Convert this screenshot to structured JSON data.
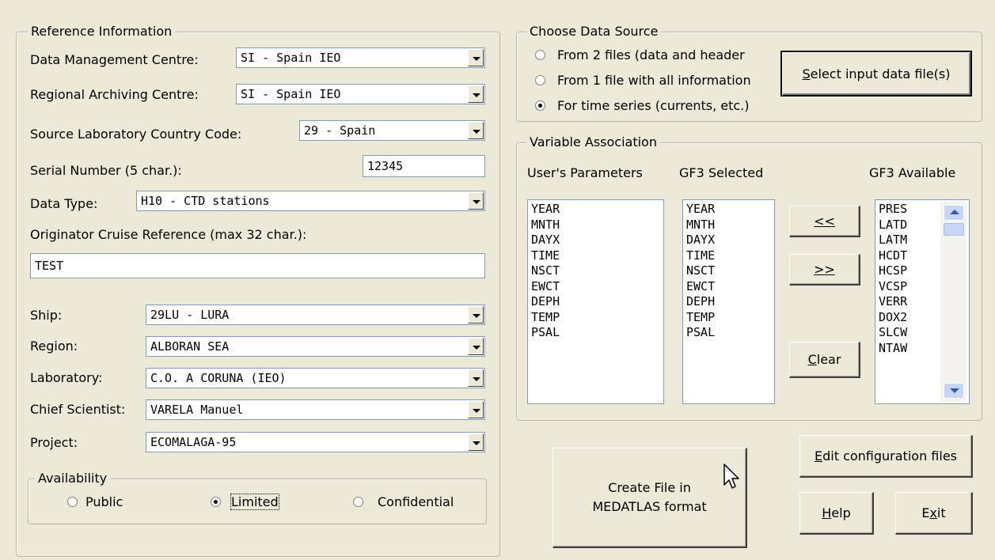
{
  "reference": {
    "legend": "Reference Information",
    "dmc_label": "Data Management Centre:",
    "dmc_value": "SI - Spain IEO",
    "rac_label": "Regional Archiving Centre:",
    "rac_value": "SI - Spain IEO",
    "country_label": "Source Laboratory Country Code:",
    "country_value": "29 - Spain",
    "serial_label": "Serial Number (5 char.):",
    "serial_value": "12345",
    "datatype_label": "Data Type:",
    "datatype_value": "H10 - CTD stations",
    "cruise_label": "Originator Cruise Reference (max 32 char.):",
    "cruise_value": "TEST",
    "ship_label": "Ship:",
    "ship_value": "29LU - LURA",
    "region_label": "Region:",
    "region_value": "ALBORAN SEA",
    "lab_label": "Laboratory:",
    "lab_value": "C.O. A CORUNA (IEO)",
    "chief_label": "Chief Scientist:",
    "chief_value": "VARELA Manuel",
    "project_label": "Project:",
    "project_value": "ECOMALAGA-95"
  },
  "availability": {
    "legend": "Availability",
    "options": [
      "Public",
      "Limited",
      "Confidential"
    ],
    "selected": "Limited"
  },
  "source": {
    "legend": "Choose Data Source",
    "options": [
      "From 2 files (data and header",
      "From 1 file with all information",
      "For time series (currents, etc.)"
    ],
    "selected": "For time series (currents, etc.)",
    "select_button_prefix": "S",
    "select_button_rest": "elect input data file(s)"
  },
  "variables": {
    "legend": "Variable Association",
    "user_header": "User's Parameters",
    "selected_header": "GF3 Selected",
    "available_header": "GF3 Available",
    "user_params": [
      "YEAR",
      "MNTH",
      "DAYX",
      "TIME",
      "NSCT",
      "EWCT",
      "DEPH",
      "TEMP",
      "PSAL"
    ],
    "gf3_selected": [
      "YEAR",
      "MNTH",
      "DAYX",
      "TIME",
      "NSCT",
      "EWCT",
      "DEPH",
      "TEMP",
      "PSAL"
    ],
    "gf3_available": [
      "PRES",
      "LATD",
      "LATM",
      "HCDT",
      "HCSP",
      "VCSP",
      "VERR",
      "DOX2",
      "SLCW",
      "NTAW"
    ],
    "btn_left": "<<",
    "btn_right": ">>",
    "btn_clear_prefix": "C",
    "btn_clear_rest": "lear"
  },
  "actions": {
    "create_line1": "Create File in",
    "create_line2": "MEDATLAS format",
    "edit_prefix": "E",
    "edit_rest": "dit configuration files",
    "help_prefix": "H",
    "help_rest": "elp",
    "exit_prefix": "E",
    "exit_mid": "x",
    "exit_rest": "it"
  }
}
